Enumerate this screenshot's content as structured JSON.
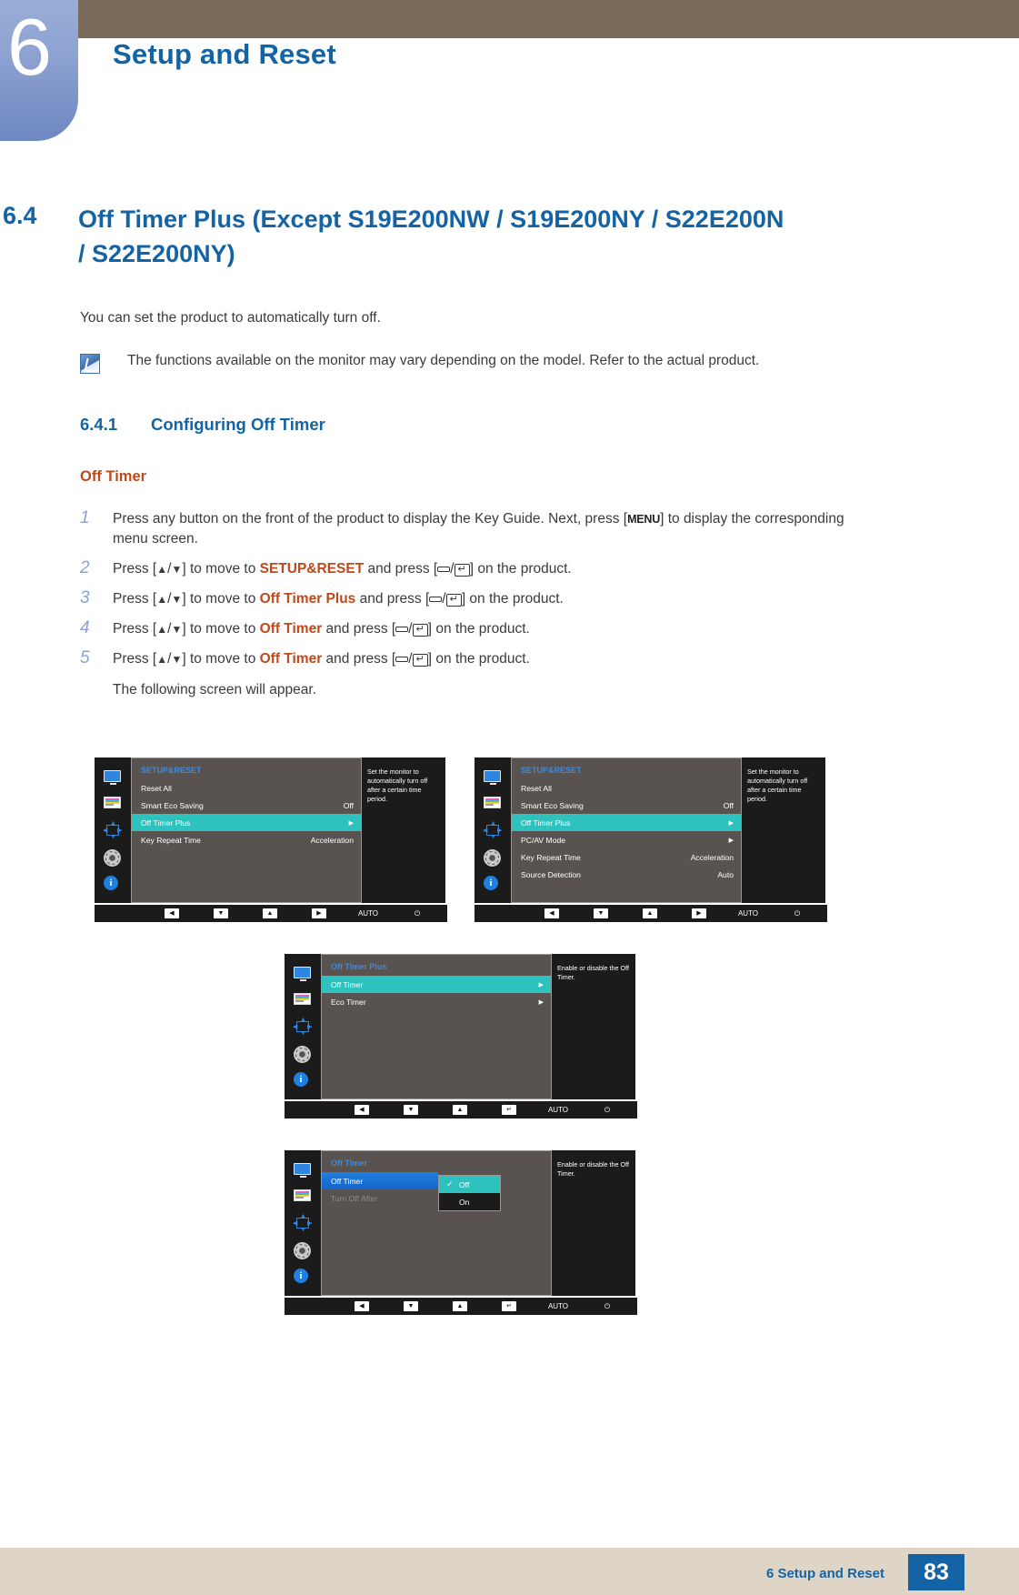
{
  "chapter": {
    "number": "6",
    "title": "Setup and Reset"
  },
  "section": {
    "number": "6.4",
    "title": "Off Timer Plus (Except S19E200NW / S19E200NY / S22E200N / S22E200NY)"
  },
  "intro": "You can set the product to automatically turn off.",
  "note": {
    "icon": "note-pencil-icon",
    "text": "The functions available on the monitor may vary depending on the model. Refer to the actual product."
  },
  "subsection": {
    "number": "6.4.1",
    "title": "Configuring Off Timer"
  },
  "topic": "Off Timer",
  "steps": [
    {
      "num": "1",
      "parts": [
        {
          "t": "text",
          "v": "Press any button on the front of the product to display the Key Guide. Next, press ["
        },
        {
          "t": "kbd",
          "v": "MENU"
        },
        {
          "t": "text",
          "v": "] to display the corresponding menu screen."
        }
      ]
    },
    {
      "num": "2",
      "parts": [
        {
          "t": "text",
          "v": "Press ["
        },
        {
          "t": "tri",
          "v": "▲"
        },
        {
          "t": "text",
          "v": "/"
        },
        {
          "t": "tri",
          "v": "▼"
        },
        {
          "t": "text",
          "v": "] to move to "
        },
        {
          "t": "hl",
          "v": "SETUP&RESET"
        },
        {
          "t": "text",
          "v": " and press ["
        },
        {
          "t": "glyph-blank",
          "v": ""
        },
        {
          "t": "text",
          "v": "/"
        },
        {
          "t": "glyph-enter",
          "v": "↵"
        },
        {
          "t": "text",
          "v": "] on the product."
        }
      ]
    },
    {
      "num": "3",
      "parts": [
        {
          "t": "text",
          "v": "Press ["
        },
        {
          "t": "tri",
          "v": "▲"
        },
        {
          "t": "text",
          "v": "/"
        },
        {
          "t": "tri",
          "v": "▼"
        },
        {
          "t": "text",
          "v": "] to move to "
        },
        {
          "t": "hl",
          "v": "Off Timer Plus"
        },
        {
          "t": "text",
          "v": " and press ["
        },
        {
          "t": "glyph-blank",
          "v": ""
        },
        {
          "t": "text",
          "v": "/"
        },
        {
          "t": "glyph-enter",
          "v": "↵"
        },
        {
          "t": "text",
          "v": "] on the product."
        }
      ]
    },
    {
      "num": "4",
      "parts": [
        {
          "t": "text",
          "v": "Press ["
        },
        {
          "t": "tri",
          "v": "▲"
        },
        {
          "t": "text",
          "v": "/"
        },
        {
          "t": "tri",
          "v": "▼"
        },
        {
          "t": "text",
          "v": "] to move to "
        },
        {
          "t": "hl",
          "v": "Off Timer"
        },
        {
          "t": "text",
          "v": " and press ["
        },
        {
          "t": "glyph-blank",
          "v": ""
        },
        {
          "t": "text",
          "v": "/"
        },
        {
          "t": "glyph-enter",
          "v": "↵"
        },
        {
          "t": "text",
          "v": "] on the product."
        }
      ]
    },
    {
      "num": "5",
      "parts": [
        {
          "t": "text",
          "v": "Press ["
        },
        {
          "t": "tri",
          "v": "▲"
        },
        {
          "t": "text",
          "v": "/"
        },
        {
          "t": "tri",
          "v": "▼"
        },
        {
          "t": "text",
          "v": "] to move to "
        },
        {
          "t": "hl",
          "v": "Off Timer"
        },
        {
          "t": "text",
          "v": " and press ["
        },
        {
          "t": "glyph-blank",
          "v": ""
        },
        {
          "t": "text",
          "v": "/"
        },
        {
          "t": "glyph-enter",
          "v": "↵"
        },
        {
          "t": "text",
          "v": "] on the product."
        }
      ]
    }
  ],
  "follow_up": "The following screen will appear.",
  "osd_screens": [
    {
      "id": "osd-setup-reset-left",
      "heading": "SETUP&RESET",
      "rows": [
        {
          "label": "Reset All",
          "value": "",
          "arrow": false,
          "selected": false
        },
        {
          "label": "Smart Eco Saving",
          "value": "Off",
          "arrow": false,
          "selected": false
        },
        {
          "label": "Off Timer Plus",
          "value": "",
          "arrow": true,
          "selected": true
        },
        {
          "label": "Key Repeat Time",
          "value": "Acceleration",
          "arrow": false,
          "selected": false
        }
      ],
      "help": "Set the monitor to automatically turn off after a certain time period.",
      "keys": [
        "◀",
        "▼",
        "▲",
        "▶",
        "AUTO",
        "⏻"
      ]
    },
    {
      "id": "osd-setup-reset-right",
      "heading": "SETUP&RESET",
      "rows": [
        {
          "label": "Reset All",
          "value": "",
          "arrow": false,
          "selected": false
        },
        {
          "label": "Smart Eco Saving",
          "value": "Off",
          "arrow": false,
          "selected": false
        },
        {
          "label": "Off Timer Plus",
          "value": "",
          "arrow": true,
          "selected": true
        },
        {
          "label": "PC/AV Mode",
          "value": "",
          "arrow": true,
          "selected": false
        },
        {
          "label": "Key Repeat Time",
          "value": "Acceleration",
          "arrow": false,
          "selected": false
        },
        {
          "label": "Source Detection",
          "value": "Auto",
          "arrow": false,
          "selected": false
        }
      ],
      "help": "Set the monitor to automatically turn off after a certain time period.",
      "keys": [
        "◀",
        "▼",
        "▲",
        "▶",
        "AUTO",
        "⏻"
      ]
    },
    {
      "id": "osd-off-timer-plus",
      "heading": "Off Timer Plus",
      "rows": [
        {
          "label": "Off Timer",
          "value": "",
          "arrow": true,
          "selected": true
        },
        {
          "label": "Eco Timer",
          "value": "",
          "arrow": true,
          "selected": false
        }
      ],
      "help": "Enable or disable the Off Timer.",
      "keys": [
        "◀",
        "▼",
        "▲",
        "↵",
        "AUTO",
        "⏻"
      ]
    },
    {
      "id": "osd-off-timer",
      "heading": "Off Timer",
      "rows": [
        {
          "label": "Off Timer",
          "value": "",
          "arrow": false,
          "selected": false,
          "blue": true
        },
        {
          "label": "Turn Off After",
          "value": "",
          "arrow": false,
          "selected": false,
          "dim": true
        }
      ],
      "popup": {
        "options": [
          {
            "label": "Off",
            "checked": true,
            "selected": true
          },
          {
            "label": "On",
            "checked": false,
            "selected": false
          }
        ]
      },
      "help": "Enable or disable the Off Timer.",
      "keys": [
        "◀",
        "▼",
        "▲",
        "↵",
        "AUTO",
        "⏻"
      ]
    }
  ],
  "rail_icons": [
    "monitor-icon",
    "color-bars-icon",
    "move-arrows-icon",
    "gear-icon",
    "info-icon"
  ],
  "footer": {
    "text": "6 Setup and Reset",
    "page": "83"
  },
  "colors": {
    "brand_blue": "#1464a5",
    "accent_orange": "#c0481a",
    "osd_highlight": "#2ec2be",
    "osd_blue": "#1f7fe0",
    "chapter_bar": "#7a6a59",
    "footer_bg": "#ded5c6"
  }
}
